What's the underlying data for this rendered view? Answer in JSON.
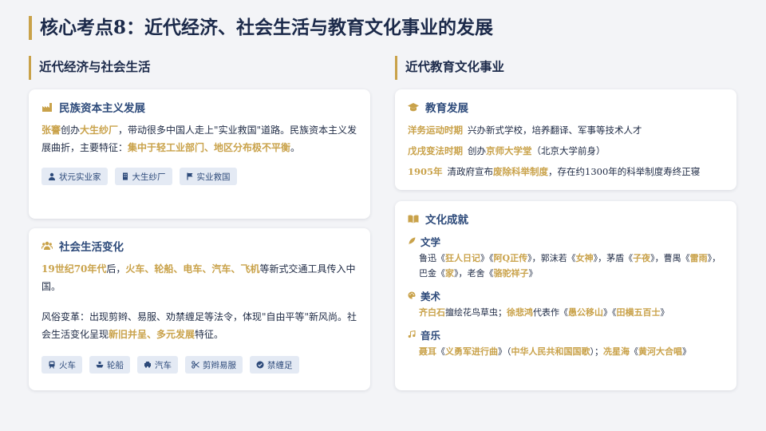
{
  "page": {
    "title": "核心考点8：近代经济、社会生活与教育文化事业的发展"
  },
  "left": {
    "heading": "近代经济与社会生活",
    "capitalism": {
      "title": "民族资本主义发展",
      "t1": "张謇",
      "t2": "创办",
      "t3": "大生纱厂",
      "t4": "，带动很多中国人走上\"实业救国\"道路。民族资本主义发展曲折，主要特征：",
      "t5": "集中于轻工业部门、地区分布极不平衡",
      "t6": "。",
      "tags": [
        "状元实业家",
        "大生纱厂",
        "实业救国"
      ]
    },
    "social": {
      "title": "社会生活变化",
      "p1a": "19世纪70年代",
      "p1b": "后，",
      "p1c": "火车、轮船、电车、汽车、飞机",
      "p1d": "等新式交通工具传入中国。",
      "p2a": "风俗变革：出现剪辫、易服、劝禁缠足等法令，体现\"自由平等\"新风尚。社会生活变化呈现",
      "p2b": "新旧并呈、多元发展",
      "p2c": "特征。",
      "tags": [
        "火车",
        "轮船",
        "汽车",
        "剪辫易服",
        "禁缠足"
      ]
    }
  },
  "right": {
    "heading": "近代教育文化事业",
    "education": {
      "title": "教育发展",
      "rows": [
        {
          "key": "洋务运动时期",
          "a": "兴办新式学校，培养翻译、军事等技术人才",
          "hl": "",
          "b": ""
        },
        {
          "key": "戊戌变法时期",
          "a": "创办",
          "hl": "京师大学堂",
          "b": "（北京大学前身）"
        },
        {
          "key": "1905年",
          "a": "清政府宣布",
          "hl": "废除科举制度",
          "b": "，存在约1300年的科举制度寿终正寝"
        }
      ]
    },
    "culture": {
      "title": "文化成就",
      "literature": {
        "label": "文学",
        "a1": "鲁迅《",
        "h1": "狂人日记",
        "a2": "》《",
        "h2": "阿Q正传",
        "a3": "》，郭沫若《",
        "h3": "女神",
        "a4": "》，茅盾《",
        "h4": "子夜",
        "a5": "》，曹禺《",
        "h5": "雷雨",
        "a6": "》，巴金《",
        "h6": "家",
        "a7": "》，老舍《",
        "h7": "骆驼祥子",
        "a8": "》"
      },
      "art": {
        "label": "美术",
        "h1": "齐白石",
        "a1": "擅绘花鸟草虫；",
        "h2": "徐悲鸿",
        "a2": "代表作《",
        "h3": "愚公移山",
        "a3": "》《",
        "h4": "田横五百士",
        "a4": "》"
      },
      "music": {
        "label": "音乐",
        "h1": "聂耳",
        "a1": "《",
        "h2": "义勇军进行曲",
        "a2": "》（",
        "h3": "中华人民共和国国歌",
        "a3": "）；",
        "h4": "冼星海",
        "a4": "《",
        "h5": "黄河大合唱",
        "a5": "》"
      }
    }
  },
  "colors": {
    "accent": "#c9a24a",
    "navy": "#1c2a4a",
    "blue": "#2d4a7a",
    "tag_bg": "#e4eaf4"
  }
}
